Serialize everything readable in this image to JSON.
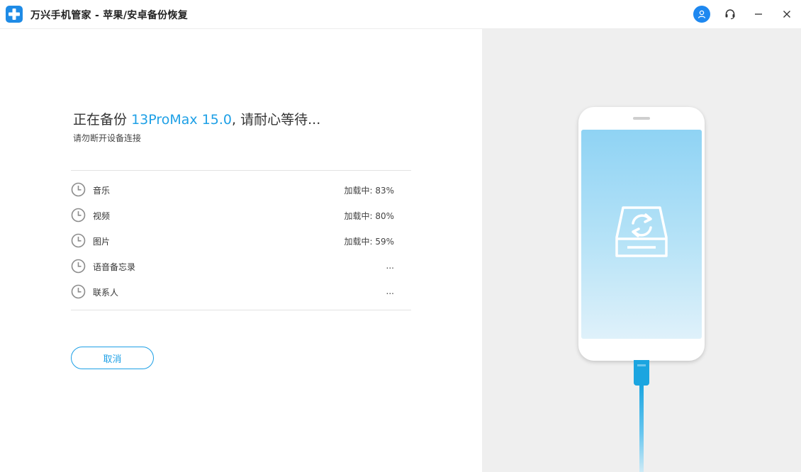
{
  "app": {
    "title": "万兴手机管家 - 苹果/安卓备份恢复"
  },
  "titlebar_buttons": [
    {
      "icon": "user-icon"
    },
    {
      "icon": "headset-icon"
    },
    {
      "icon": "minimize-icon"
    },
    {
      "icon": "close-icon"
    }
  ],
  "backup": {
    "heading_prefix": "正在备份",
    "device_name": "13ProMax",
    "device_version": "15.0",
    "heading_suffix": ", 请耐心等待...",
    "subheading": "请勿断开设备连接",
    "items": [
      {
        "label": "音乐",
        "status": "加载中: 83%",
        "icon": "clock-icon"
      },
      {
        "label": "视频",
        "status": "加载中: 80%",
        "icon": "clock-icon"
      },
      {
        "label": "图片",
        "status": "加载中: 59%",
        "icon": "clock-icon"
      },
      {
        "label": "语音备忘录",
        "status": "...",
        "icon": "clock-icon"
      },
      {
        "label": "联系人",
        "status": "...",
        "icon": "clock-icon"
      }
    ],
    "cancel_label": "取消"
  },
  "colors": {
    "accent": "#1ea0e6",
    "logo": "#1e8be6",
    "user_avatar": "#1e88f0",
    "right_panel_bg": "#efefef",
    "cable": "#1ba5e0"
  },
  "illustration": {
    "icon": "sync-drive-icon"
  }
}
